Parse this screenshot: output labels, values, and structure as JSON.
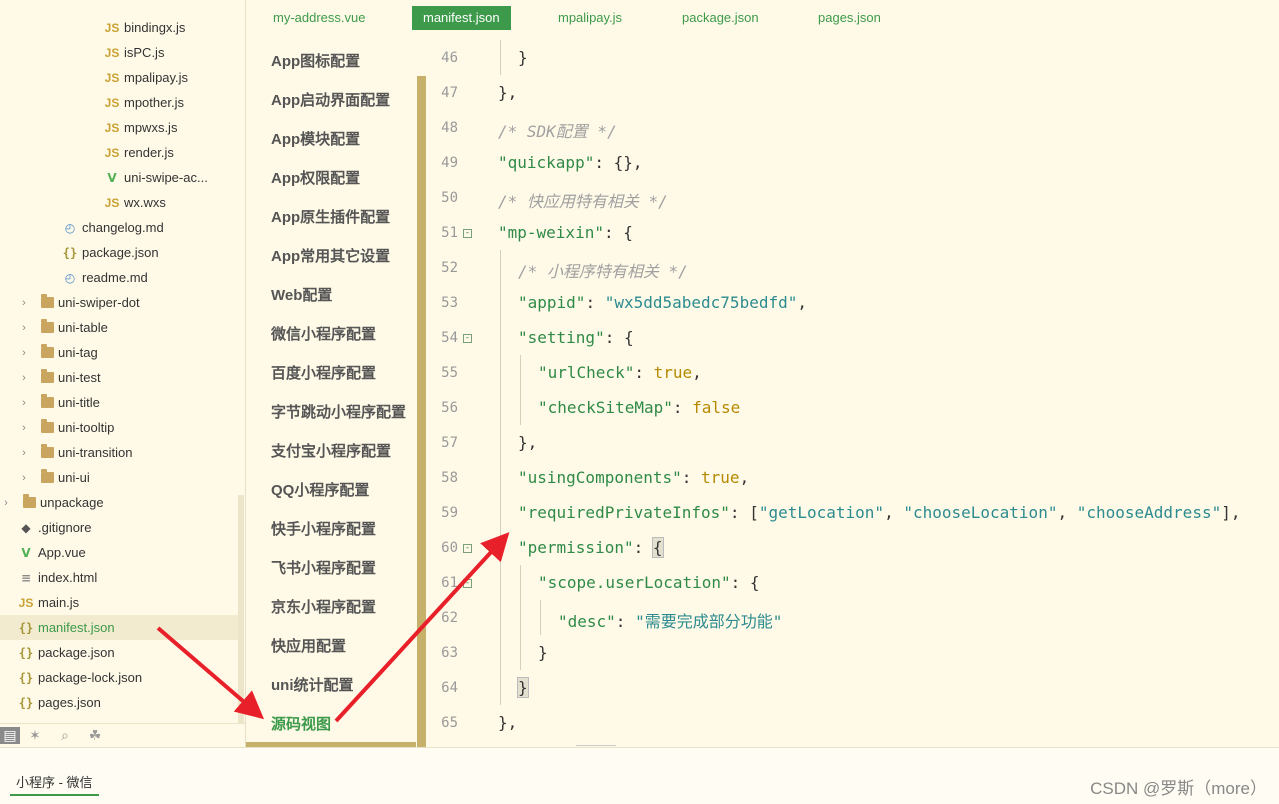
{
  "file_tree": {
    "items": [
      {
        "label": "bindingx.js",
        "icon": "js-icon",
        "indent": 3
      },
      {
        "label": "isPC.js",
        "icon": "js-icon",
        "indent": 3
      },
      {
        "label": "mpalipay.js",
        "icon": "js-icon",
        "indent": 3
      },
      {
        "label": "mpother.js",
        "icon": "js-icon",
        "indent": 3
      },
      {
        "label": "mpwxs.js",
        "icon": "js-icon",
        "indent": 3
      },
      {
        "label": "render.js",
        "icon": "js-icon",
        "indent": 3
      },
      {
        "label": "uni-swipe-ac...",
        "icon": "vue-icon",
        "indent": 3
      },
      {
        "label": "wx.wxs",
        "icon": "file-icon",
        "indent": 3
      },
      {
        "label": "changelog.md",
        "icon": "md-icon",
        "indent": 2
      },
      {
        "label": "package.json",
        "icon": "json-icon",
        "indent": 2
      },
      {
        "label": "readme.md",
        "icon": "md-icon",
        "indent": 2
      },
      {
        "label": "uni-swiper-dot",
        "icon": "folder-icon",
        "indent": 1,
        "arrow": "›"
      },
      {
        "label": "uni-table",
        "icon": "folder-icon",
        "indent": 1,
        "arrow": "›"
      },
      {
        "label": "uni-tag",
        "icon": "folder-icon",
        "indent": 1,
        "arrow": "›"
      },
      {
        "label": "uni-test",
        "icon": "folder-icon",
        "indent": 1,
        "arrow": "›"
      },
      {
        "label": "uni-title",
        "icon": "folder-icon",
        "indent": 1,
        "arrow": "›"
      },
      {
        "label": "uni-tooltip",
        "icon": "folder-icon",
        "indent": 1,
        "arrow": "›"
      },
      {
        "label": "uni-transition",
        "icon": "folder-icon",
        "indent": 1,
        "arrow": "›"
      },
      {
        "label": "uni-ui",
        "icon": "folder-icon",
        "indent": 1,
        "arrow": "›"
      },
      {
        "label": "unpackage",
        "icon": "folder-icon",
        "indent": 0,
        "arrow": "›"
      },
      {
        "label": ".gitignore",
        "icon": "git-icon",
        "indent": 0
      },
      {
        "label": "App.vue",
        "icon": "vue-icon",
        "indent": 0
      },
      {
        "label": "index.html",
        "icon": "html-icon",
        "indent": 0
      },
      {
        "label": "main.js",
        "icon": "js-icon",
        "indent": 0
      },
      {
        "label": "manifest.json",
        "icon": "json-icon",
        "indent": 0,
        "selected": true
      },
      {
        "label": "package.json",
        "icon": "json-icon",
        "indent": 0
      },
      {
        "label": "package-lock.json",
        "icon": "json-icon",
        "indent": 0
      },
      {
        "label": "pages.json",
        "icon": "json-icon",
        "indent": 0
      }
    ],
    "bottom_icons": [
      "files-icon",
      "bug-icon",
      "search-icon",
      "plugin-icon"
    ]
  },
  "tabs": [
    {
      "label": "my-address.vue",
      "active": false
    },
    {
      "label": "manifest.json",
      "active": true
    },
    {
      "label": "mpalipay.js",
      "active": false
    },
    {
      "label": "package.json",
      "active": false
    },
    {
      "label": "pages.json",
      "active": false
    }
  ],
  "config_menu": [
    {
      "label": "App图标配置"
    },
    {
      "label": "App启动界面配置"
    },
    {
      "label": "App模块配置"
    },
    {
      "label": "App权限配置"
    },
    {
      "label": "App原生插件配置"
    },
    {
      "label": "App常用其它设置"
    },
    {
      "label": "Web配置"
    },
    {
      "label": "微信小程序配置"
    },
    {
      "label": "百度小程序配置"
    },
    {
      "label": "字节跳动小程序配置"
    },
    {
      "label": "支付宝小程序配置"
    },
    {
      "label": "QQ小程序配置"
    },
    {
      "label": "快手小程序配置"
    },
    {
      "label": "飞书小程序配置"
    },
    {
      "label": "京东小程序配置"
    },
    {
      "label": "快应用配置"
    },
    {
      "label": "uni统计配置"
    },
    {
      "label": "源码视图",
      "active": true
    }
  ],
  "code_lines": [
    {
      "n": "46",
      "indent": 1,
      "fold": false,
      "parts": [
        [
          "p",
          "}"
        ]
      ]
    },
    {
      "n": "47",
      "indent": 0,
      "fold": false,
      "parts": [
        [
          "p",
          "},"
        ]
      ]
    },
    {
      "n": "48",
      "indent": 0,
      "fold": false,
      "parts": [
        [
          "c",
          "/* SDK配置 */"
        ]
      ]
    },
    {
      "n": "49",
      "indent": 0,
      "fold": false,
      "parts": [
        [
          "k",
          "\"quickapp\""
        ],
        [
          "p",
          ": {},"
        ]
      ]
    },
    {
      "n": "50",
      "indent": 0,
      "fold": false,
      "parts": [
        [
          "c",
          "/* 快应用特有相关 */"
        ]
      ]
    },
    {
      "n": "51",
      "indent": 0,
      "fold": true,
      "parts": [
        [
          "k",
          "\"mp-weixin\""
        ],
        [
          "p",
          ": {"
        ]
      ]
    },
    {
      "n": "52",
      "indent": 1,
      "fold": false,
      "parts": [
        [
          "c",
          "/* 小程序特有相关 */"
        ]
      ]
    },
    {
      "n": "53",
      "indent": 1,
      "fold": false,
      "parts": [
        [
          "k",
          "\"appid\""
        ],
        [
          "p",
          ": "
        ],
        [
          "s",
          "\"wx5dd5abedc75bedfd\""
        ],
        [
          "p",
          ","
        ]
      ]
    },
    {
      "n": "54",
      "indent": 1,
      "fold": true,
      "parts": [
        [
          "k",
          "\"setting\""
        ],
        [
          "p",
          ": {"
        ]
      ]
    },
    {
      "n": "55",
      "indent": 2,
      "fold": false,
      "parts": [
        [
          "k",
          "\"urlCheck\""
        ],
        [
          "p",
          ": "
        ],
        [
          "b",
          "true"
        ],
        [
          "p",
          ","
        ]
      ]
    },
    {
      "n": "56",
      "indent": 2,
      "fold": false,
      "parts": [
        [
          "k",
          "\"checkSiteMap\""
        ],
        [
          "p",
          ": "
        ],
        [
          "b",
          "false"
        ]
      ]
    },
    {
      "n": "57",
      "indent": 1,
      "fold": false,
      "parts": [
        [
          "p",
          "},"
        ]
      ]
    },
    {
      "n": "58",
      "indent": 1,
      "fold": false,
      "parts": [
        [
          "k",
          "\"usingComponents\""
        ],
        [
          "p",
          ": "
        ],
        [
          "b",
          "true"
        ],
        [
          "p",
          ","
        ]
      ]
    },
    {
      "n": "59",
      "indent": 1,
      "fold": false,
      "parts": [
        [
          "k",
          "\"requiredPrivateInfos\""
        ],
        [
          "p",
          ": ["
        ],
        [
          "s",
          "\"getLocation\""
        ],
        [
          "p",
          ", "
        ],
        [
          "s",
          "\"chooseLocation\""
        ],
        [
          "p",
          ", "
        ],
        [
          "s",
          "\"chooseAddress\""
        ],
        [
          "p",
          "],"
        ]
      ]
    },
    {
      "n": "60",
      "indent": 1,
      "fold": true,
      "parts": [
        [
          "k",
          "\"permission\""
        ],
        [
          "p",
          ": "
        ],
        [
          "h",
          "{"
        ]
      ]
    },
    {
      "n": "61",
      "indent": 2,
      "fold": true,
      "parts": [
        [
          "k",
          "\"scope.userLocation\""
        ],
        [
          "p",
          ": {"
        ]
      ]
    },
    {
      "n": "62",
      "indent": 3,
      "fold": false,
      "parts": [
        [
          "k",
          "\"desc\""
        ],
        [
          "p",
          ": "
        ],
        [
          "s",
          "\"需要完成部分功能\""
        ]
      ]
    },
    {
      "n": "63",
      "indent": 2,
      "fold": false,
      "parts": [
        [
          "p",
          "}"
        ]
      ]
    },
    {
      "n": "64",
      "indent": 1,
      "fold": false,
      "parts": [
        [
          "h",
          "}"
        ]
      ]
    },
    {
      "n": "65",
      "indent": 0,
      "fold": false,
      "parts": [
        [
          "p",
          "},"
        ]
      ]
    }
  ],
  "statusbar": {
    "tab_label": "小程序 - 微信",
    "watermark": "CSDN @罗斯（more）"
  },
  "annotation_color": "#e8202a"
}
